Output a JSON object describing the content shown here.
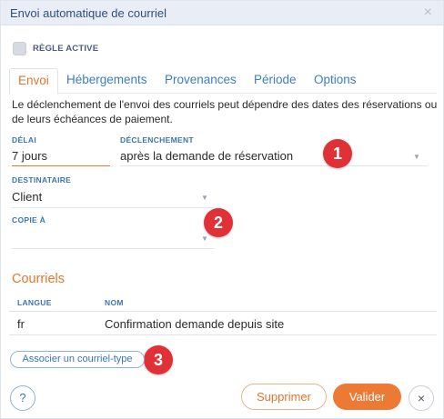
{
  "window": {
    "title": "Envoi automatique de courriel",
    "close_glyph": "×"
  },
  "active_rule": {
    "label": "RÈGLE ACTIVE",
    "checked": false
  },
  "tabs": [
    {
      "label": "Envoi",
      "active": true
    },
    {
      "label": "Hébergements",
      "active": false
    },
    {
      "label": "Provenances",
      "active": false
    },
    {
      "label": "Période",
      "active": false
    },
    {
      "label": "Options",
      "active": false
    }
  ],
  "description": "Le déclenchement de l'envoi des courriels peut dépendre des dates des réservations ou de leurs échéances de paiement.",
  "fields": {
    "delay": {
      "label": "DÉLAI",
      "value": "7 jours"
    },
    "trigger": {
      "label": "DÉCLENCHEMENT",
      "value": "après la demande de réservation"
    },
    "recipient": {
      "label": "DESTINATAIRE",
      "value": "Client"
    },
    "copy_to": {
      "label": "COPIE À",
      "value": ""
    }
  },
  "badges": [
    "1",
    "2",
    "3"
  ],
  "emails": {
    "title": "Courriels",
    "columns": [
      "LANGUE",
      "NOM"
    ],
    "rows": [
      {
        "language": "fr",
        "name": "Confirmation demande depuis site"
      }
    ],
    "associate_button": "Associer un courriel-type"
  },
  "footer": {
    "help": "?",
    "delete": "Supprimer",
    "submit": "Valider",
    "close": "×"
  },
  "colors": {
    "accent": "#e3762f",
    "link": "#3b74b8",
    "badge": "#e03136"
  }
}
